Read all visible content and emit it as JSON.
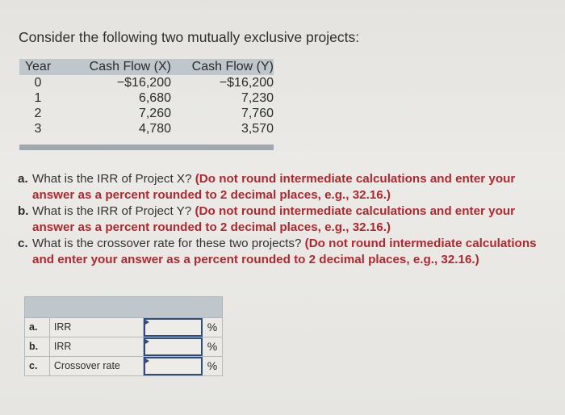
{
  "intro": "Consider the following two mutually exclusive projects:",
  "cash_flows": {
    "headers": [
      "Year",
      "Cash Flow (X)",
      "Cash Flow (Y)"
    ],
    "rows": [
      [
        "0",
        "−$16,200",
        "−$16,200"
      ],
      [
        "1",
        "6,680",
        "7,230"
      ],
      [
        "2",
        "7,260",
        "7,760"
      ],
      [
        "3",
        "4,780",
        "3,570"
      ]
    ]
  },
  "questions": [
    {
      "label": "a.",
      "text": "What is the IRR of Project X? ",
      "note": "(Do not round intermediate calculations and enter your answer as a percent rounded to 2 decimal places, e.g., 32.16.)"
    },
    {
      "label": "b.",
      "text": "What is the IRR of Project Y? ",
      "note": "(Do not round intermediate calculations and enter your answer as a percent rounded to 2 decimal places, e.g., 32.16.)"
    },
    {
      "label": "c.",
      "text": "What is the crossover rate for these two projects? ",
      "note": "(Do not round intermediate calculations and enter your answer as a percent rounded to 2 decimal places, e.g., 32.16.)"
    }
  ],
  "answers": [
    {
      "label": "a.",
      "name": "IRR",
      "value": "",
      "unit": "%"
    },
    {
      "label": "b.",
      "name": "IRR",
      "value": "",
      "unit": "%"
    },
    {
      "label": "c.",
      "name": "Crossover rate",
      "value": "",
      "unit": "%"
    }
  ]
}
